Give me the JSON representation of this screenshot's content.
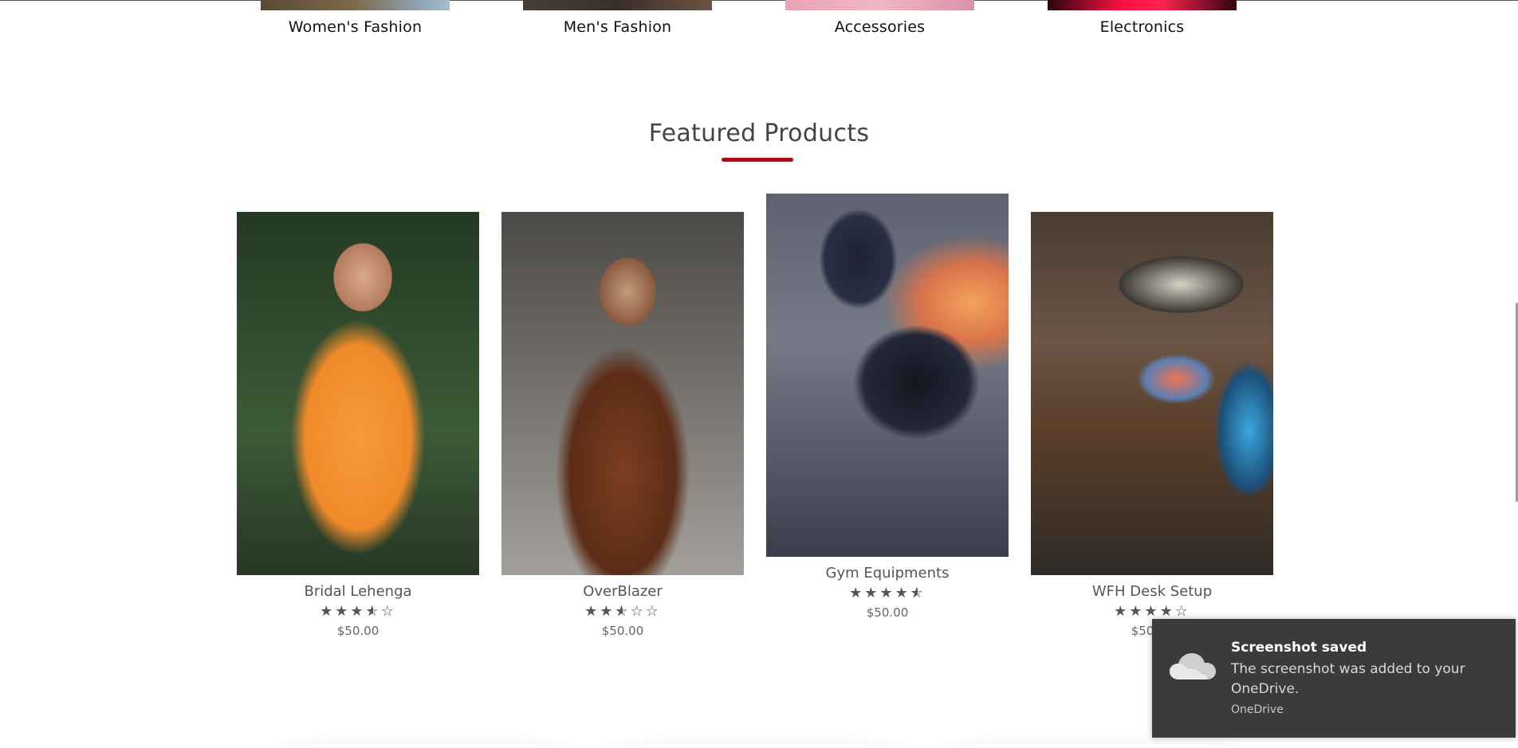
{
  "categories": [
    {
      "label": "Women's Fashion"
    },
    {
      "label": "Men's Fashion"
    },
    {
      "label": "Accessories"
    },
    {
      "label": "Electronics"
    }
  ],
  "featured": {
    "title": "Featured Products",
    "accent_color": "#a30f17",
    "products": [
      {
        "name": "Bridal Lehenga",
        "price": "$50.00",
        "rating": 3.5,
        "max_rating": 5
      },
      {
        "name": "OverBlazer",
        "price": "$50.00",
        "rating": 2.5,
        "max_rating": 5
      },
      {
        "name": "Gym Equipments",
        "price": "$50.00",
        "rating": 4.5,
        "max_rating": 5
      },
      {
        "name": "WFH Desk Setup",
        "price": "$50.00",
        "rating": 4,
        "max_rating": 5
      }
    ]
  },
  "toast": {
    "title": "Screenshot saved",
    "body": "The screenshot was added to your OneDrive.",
    "app": "OneDrive",
    "icon": "cloud-icon",
    "background": "#3b3b3b"
  }
}
